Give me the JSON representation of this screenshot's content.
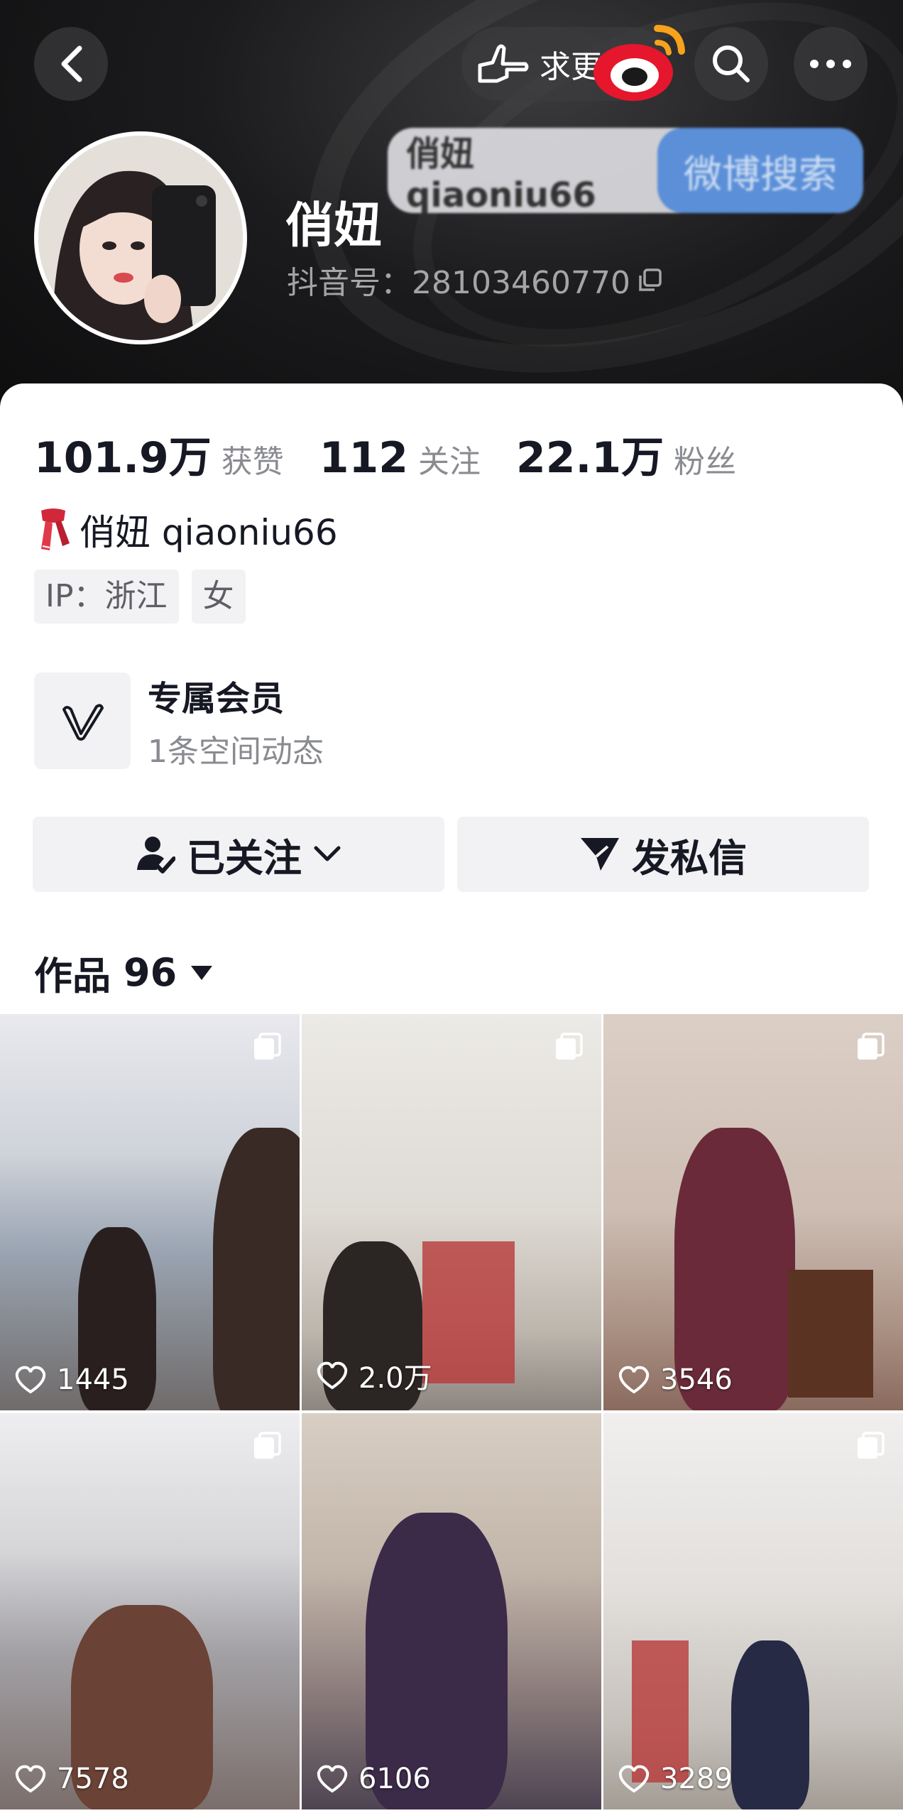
{
  "header": {
    "request_update_label": "求更新",
    "weibo_search": {
      "query": "俏妞qiaoniu66",
      "button_label": "微博搜索"
    }
  },
  "profile": {
    "name": "俏妞",
    "douyin_id": "抖音号：28103460770"
  },
  "stats": [
    {
      "value": "101.9万",
      "label": "获赞"
    },
    {
      "value": "112",
      "label": "关注"
    },
    {
      "value": "22.1万",
      "label": "粉丝"
    }
  ],
  "bio": {
    "text": "俏妞 qiaoniu66"
  },
  "tags": [
    "IP：浙江",
    "女"
  ],
  "membership": {
    "title": "专属会员",
    "subtitle": "1条空间动态"
  },
  "actions": {
    "follow_label": "已关注",
    "message_label": "发私信"
  },
  "works": {
    "label": "作品",
    "count": "96"
  },
  "videos": [
    {
      "likes": "1445"
    },
    {
      "likes": "2.0万"
    },
    {
      "likes": "3546"
    },
    {
      "likes": "7578"
    },
    {
      "likes": "6106"
    },
    {
      "likes": "3289"
    }
  ],
  "colors": {
    "header_bg": "#1b1b1d",
    "button_bg": "#f2f2f4",
    "text_primary": "#161823",
    "text_secondary": "#8a8b91"
  }
}
